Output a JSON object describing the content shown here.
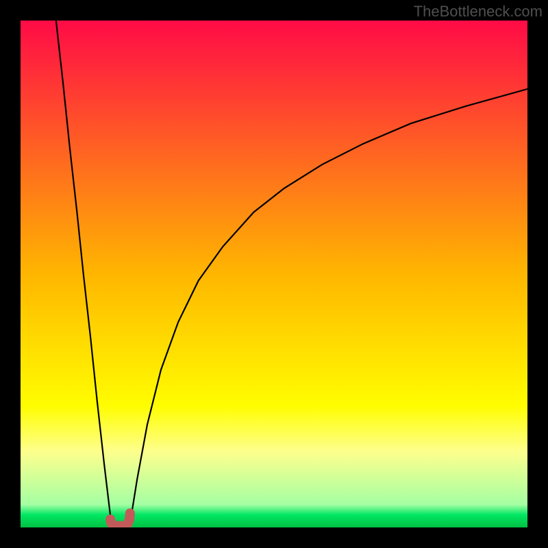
{
  "watermark": "TheBottleneck.com",
  "chart_data": {
    "type": "line",
    "title": "",
    "xlabel": "",
    "ylabel": "",
    "xlim": [
      0,
      100
    ],
    "ylim": [
      0,
      100
    ],
    "grid": false,
    "legend": false,
    "gradient_stops": [
      {
        "offset": 0.0,
        "color": "#ff0b46"
      },
      {
        "offset": 0.5,
        "color": "#ffb600"
      },
      {
        "offset": 0.76,
        "color": "#fffd00"
      },
      {
        "offset": 0.85,
        "color": "#feff8d"
      },
      {
        "offset": 0.955,
        "color": "#a4ffa3"
      },
      {
        "offset": 0.975,
        "color": "#00e763"
      },
      {
        "offset": 1.0,
        "color": "#00c142"
      }
    ],
    "series": [
      {
        "name": "left-branch",
        "x": [
          7.0,
          8.4,
          9.7,
          11.1,
          12.4,
          13.8,
          15.1,
          16.5,
          17.9
        ],
        "y": [
          100.0,
          87.5,
          75.0,
          62.5,
          50.0,
          37.5,
          25.0,
          12.5,
          0.8
        ]
      },
      {
        "name": "right-branch",
        "x": [
          21.6,
          23.0,
          25.0,
          27.7,
          31.1,
          35.1,
          39.9,
          46.0,
          52.0,
          59.5,
          67.6,
          77.0,
          87.8,
          100.0
        ],
        "y": [
          0.8,
          9.5,
          20.3,
          31.1,
          40.5,
          48.7,
          55.4,
          62.2,
          66.9,
          71.6,
          75.7,
          79.7,
          83.1,
          86.5
        ]
      }
    ],
    "marker": {
      "name": "bottleneck-u-marker",
      "color": "#c25a5a",
      "points_xy": [
        [
          17.7,
          1.6
        ],
        [
          17.9,
          0.8
        ],
        [
          18.2,
          0.5
        ],
        [
          18.9,
          0.3
        ],
        [
          19.6,
          0.3
        ],
        [
          20.3,
          0.3
        ],
        [
          20.9,
          0.5
        ],
        [
          21.2,
          0.8
        ],
        [
          21.5,
          1.6
        ],
        [
          21.6,
          2.8
        ]
      ]
    }
  }
}
